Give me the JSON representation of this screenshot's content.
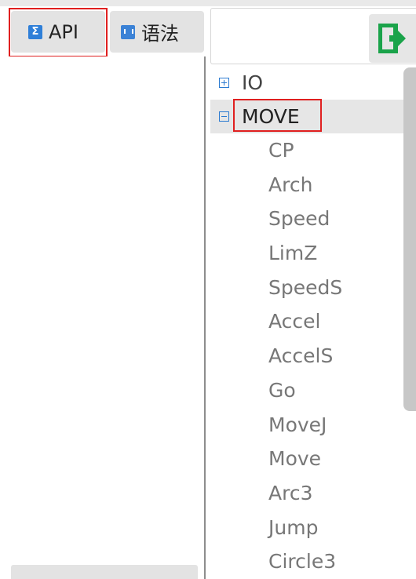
{
  "tabs": [
    {
      "label": "API",
      "icon": "sigma-icon",
      "active": true
    },
    {
      "label": "语法",
      "icon": "code-book-icon",
      "active": false
    }
  ],
  "search": {
    "placeholder": ""
  },
  "exit_button": {
    "icon": "exit-icon",
    "color": "#1aa34a"
  },
  "tree": {
    "nodes": [
      {
        "label": "IO",
        "expanded": false,
        "icon": "plus-box-icon"
      },
      {
        "label": "MOVE",
        "expanded": true,
        "icon": "minus-box-icon",
        "children": [
          "CP",
          "Arch",
          "Speed",
          "LimZ",
          "SpeedS",
          "Accel",
          "AccelS",
          "Go",
          "MoveJ",
          "Move",
          "Arc3",
          "Jump",
          "Circle3"
        ]
      }
    ]
  },
  "colors": {
    "accent": "#2c7bd1",
    "highlight": "#e02020",
    "tab_bg": "#e3e3e3"
  }
}
